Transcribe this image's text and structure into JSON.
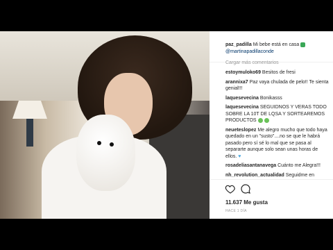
{
  "post": {
    "username": "paz_padilla",
    "caption": "Mi bebe está en casa",
    "mention": "@martinapadillaconde",
    "load_more": "Cargar más comentarios",
    "comments": [
      {
        "user": "estoymuloko69",
        "text": "Besitos de fresi"
      },
      {
        "user": "arannixa7",
        "text": "Paz vaya chulada de pelo!! Te sienta genial!!!"
      },
      {
        "user": "laquesevecina",
        "text": "Bonikasss"
      },
      {
        "user": "laquesevecina",
        "text": "SEGUIDNOS Y VERAS TODO SOBRE LA 10T DE LQSA Y SORTEAREMOS PRODUCTOS"
      },
      {
        "user": "neueteslopez",
        "text": "Me alegro mucho que todo haya quedado en un \"susto\"....no se que le habrá pasado pero sí sé lo mal que se pasa al separarte aunque solo sean unas horas de ellos."
      },
      {
        "user": "rosadeliasantanavega",
        "text": "Cuánto me Alegra!!!"
      },
      {
        "user": "nh_revolution_actualidad",
        "text": "Seguidme en"
      }
    ],
    "likes": "11.637 Me gusta",
    "time": "HACE 1 DÍA"
  },
  "icons": {
    "like": "heart-icon",
    "comment": "comment-icon",
    "caption_emoji": "house-emoji-icon",
    "comment_emoji": "green-face-emoji-icon",
    "comment_heart": "blue-heart-icon"
  },
  "colors": {
    "link": "#003569",
    "muted": "#999999",
    "text": "#262626",
    "emoji": "#6ac259"
  }
}
